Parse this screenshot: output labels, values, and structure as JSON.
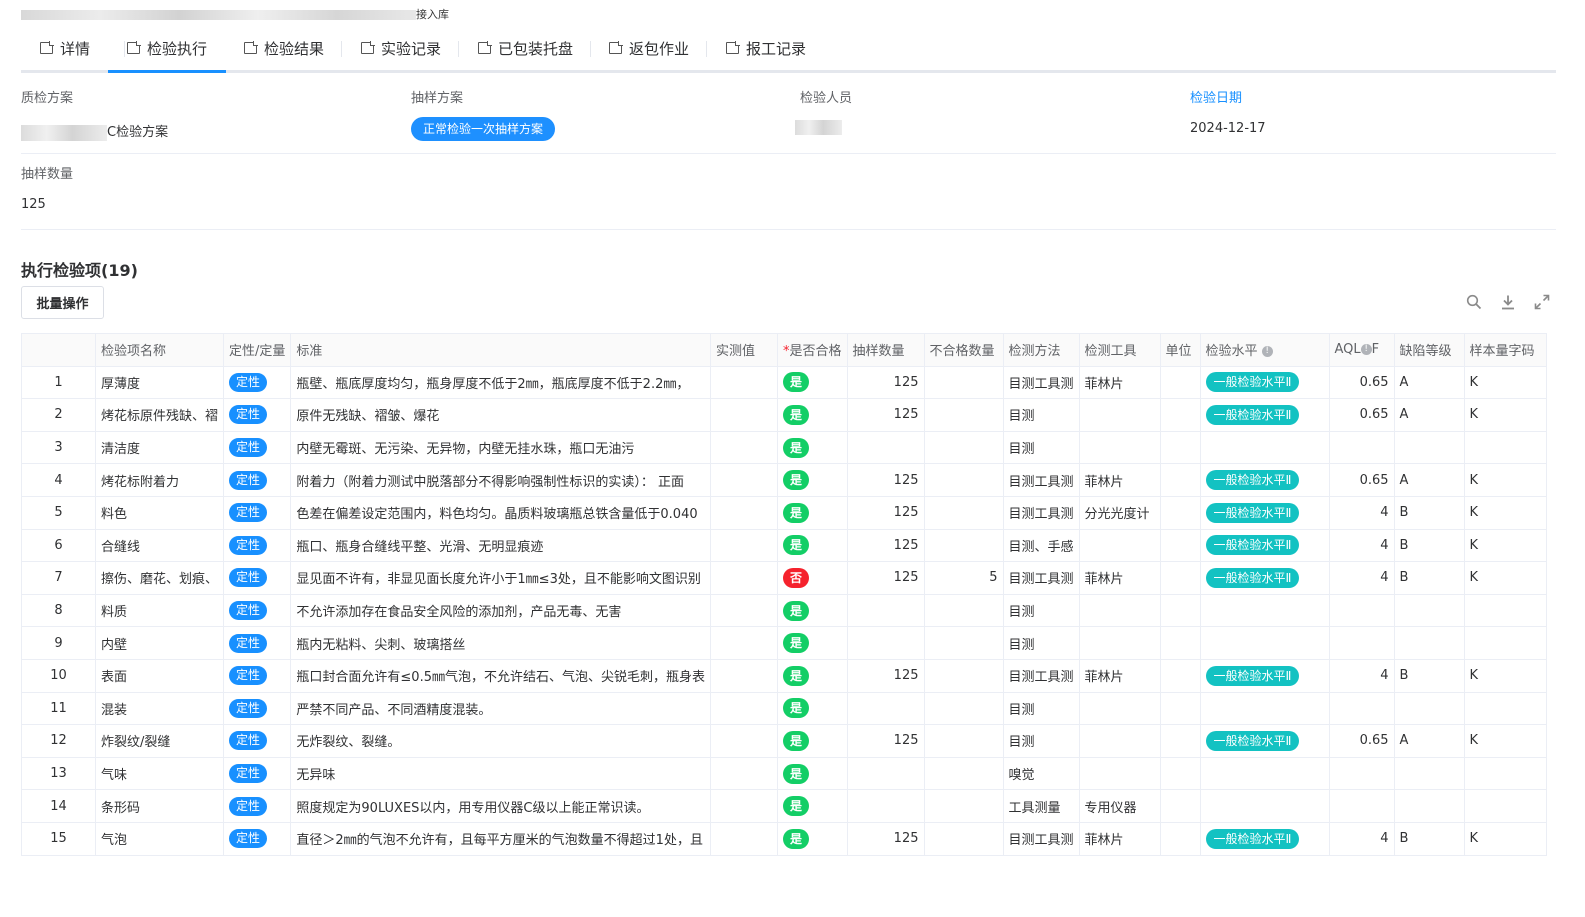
{
  "breadcrumb": {
    "text": "接入库"
  },
  "tabs": [
    {
      "label": "详情"
    },
    {
      "label": "检验执行"
    },
    {
      "label": "检验结果"
    },
    {
      "label": "实验记录"
    },
    {
      "label": "已包装托盘"
    },
    {
      "label": "返包作业"
    },
    {
      "label": "报工记录"
    }
  ],
  "fields": {
    "qc_plan_label": "质检方案",
    "qc_plan_value": "C检验方案",
    "sampling_plan_label": "抽样方案",
    "sampling_plan_value": "正常检验一次抽样方案",
    "inspector_label": "检验人员",
    "inspect_date_label": "检验日期",
    "inspect_date_value": "2024-12-17",
    "sample_qty_label": "抽样数量",
    "sample_qty_value": "125"
  },
  "section": {
    "title": "执行检验项(19)",
    "batch_button": "批量操作"
  },
  "toolbar": {
    "icons": [
      "search-icon",
      "download-icon",
      "fullscreen-icon"
    ]
  },
  "table": {
    "headers": {
      "name": "检验项名称",
      "qual": "定性/定量",
      "std": "标准",
      "measured": "实测值",
      "pass_req": "*",
      "pass": "是否合格",
      "sample": "抽样数量",
      "fail": "不合格数量",
      "method": "检测方法",
      "tool": "检测工具",
      "unit": "单位",
      "level": "检验水平",
      "aql": "AQL",
      "aql_tail": "F",
      "defect": "缺陷等级",
      "code": "样本量字码"
    },
    "rows": [
      {
        "idx": "1",
        "name": "厚薄度",
        "qual": "定性",
        "std": "瓶壁、瓶底厚度均匀，瓶身厚度不低于2㎜，瓶底厚度不低于2.2㎜，",
        "pass": "是",
        "sample": "125",
        "fail": "",
        "method": "目测工具测",
        "tool": "菲林片",
        "unit": "",
        "level": "一般检验水平Ⅱ",
        "aql": "0.65",
        "defect": "A",
        "code": "K"
      },
      {
        "idx": "2",
        "name": "烤花标原件残缺、褶",
        "qual": "定性",
        "std": "原件无残缺、褶皱、爆花",
        "pass": "是",
        "sample": "125",
        "fail": "",
        "method": "目测",
        "tool": "",
        "unit": "",
        "level": "一般检验水平Ⅱ",
        "aql": "0.65",
        "defect": "A",
        "code": "K"
      },
      {
        "idx": "3",
        "name": "清洁度",
        "qual": "定性",
        "std": "内壁无霉斑、无污染、无异物，内壁无挂水珠，瓶口无油污",
        "pass": "是",
        "sample": "",
        "fail": "",
        "method": "目测",
        "tool": "",
        "unit": "",
        "level": "",
        "aql": "",
        "defect": "",
        "code": ""
      },
      {
        "idx": "4",
        "name": "烤花标附着力",
        "qual": "定性",
        "std": "附着力（附着力测试中脱落部分不得影响强制性标识的实读）： 正面",
        "pass": "是",
        "sample": "125",
        "fail": "",
        "method": "目测工具测",
        "tool": "菲林片",
        "unit": "",
        "level": "一般检验水平Ⅱ",
        "aql": "0.65",
        "defect": "A",
        "code": "K"
      },
      {
        "idx": "5",
        "name": "料色",
        "qual": "定性",
        "std": "色差在偏差设定范围内，料色均匀。晶质料玻璃瓶总铁含量低于0.040",
        "pass": "是",
        "sample": "125",
        "fail": "",
        "method": "目测工具测",
        "tool": "分光光度计",
        "unit": "",
        "level": "一般检验水平Ⅱ",
        "aql": "4",
        "defect": "B",
        "code": "K"
      },
      {
        "idx": "6",
        "name": "合缝线",
        "qual": "定性",
        "std": "瓶口、瓶身合缝线平整、光滑、无明显痕迹",
        "pass": "是",
        "sample": "125",
        "fail": "",
        "method": "目测、手感",
        "tool": "",
        "unit": "",
        "level": "一般检验水平Ⅱ",
        "aql": "4",
        "defect": "B",
        "code": "K"
      },
      {
        "idx": "7",
        "name": "擦伤、磨花、划痕、",
        "qual": "定性",
        "std": "显见面不许有，非显见面长度允许小于1㎜≤3处，且不能影响文图识别",
        "pass": "否",
        "sample": "125",
        "fail": "5",
        "method": "目测工具测",
        "tool": "菲林片",
        "unit": "",
        "level": "一般检验水平Ⅱ",
        "aql": "4",
        "defect": "B",
        "code": "K"
      },
      {
        "idx": "8",
        "name": "料质",
        "qual": "定性",
        "std": "不允许添加存在食品安全风险的添加剂，产品无毒、无害",
        "pass": "是",
        "sample": "",
        "fail": "",
        "method": "目测",
        "tool": "",
        "unit": "",
        "level": "",
        "aql": "",
        "defect": "",
        "code": ""
      },
      {
        "idx": "9",
        "name": "内壁",
        "qual": "定性",
        "std": "瓶内无粘料、尖刺、玻璃搭丝",
        "pass": "是",
        "sample": "",
        "fail": "",
        "method": "目测",
        "tool": "",
        "unit": "",
        "level": "",
        "aql": "",
        "defect": "",
        "code": ""
      },
      {
        "idx": "10",
        "name": "表面",
        "qual": "定性",
        "std": "瓶口封合面允许有≤0.5㎜气泡，不允许结石、气泡、尖锐毛刺，瓶身表",
        "pass": "是",
        "sample": "125",
        "fail": "",
        "method": "目测工具测",
        "tool": "菲林片",
        "unit": "",
        "level": "一般检验水平Ⅱ",
        "aql": "4",
        "defect": "B",
        "code": "K"
      },
      {
        "idx": "11",
        "name": "混装",
        "qual": "定性",
        "std": "严禁不同产品、不同酒精度混装。",
        "pass": "是",
        "sample": "",
        "fail": "",
        "method": "目测",
        "tool": "",
        "unit": "",
        "level": "",
        "aql": "",
        "defect": "",
        "code": ""
      },
      {
        "idx": "12",
        "name": "炸裂纹/裂缝",
        "qual": "定性",
        "std": "无炸裂纹、裂缝。",
        "pass": "是",
        "sample": "125",
        "fail": "",
        "method": "目测",
        "tool": "",
        "unit": "",
        "level": "一般检验水平Ⅱ",
        "aql": "0.65",
        "defect": "A",
        "code": "K"
      },
      {
        "idx": "13",
        "name": "气味",
        "qual": "定性",
        "std": "无异味",
        "pass": "是",
        "sample": "",
        "fail": "",
        "method": "嗅觉",
        "tool": "",
        "unit": "",
        "level": "",
        "aql": "",
        "defect": "",
        "code": ""
      },
      {
        "idx": "14",
        "name": "条形码",
        "qual": "定性",
        "std": "照度规定为90LUXES以内，用专用仪器C级以上能正常识读。",
        "pass": "是",
        "sample": "",
        "fail": "",
        "method": "工具测量",
        "tool": "专用仪器",
        "unit": "",
        "level": "",
        "aql": "",
        "defect": "",
        "code": ""
      },
      {
        "idx": "15",
        "name": "气泡",
        "qual": "定性",
        "std": "直径＞2㎜的气泡不允许有，且每平方厘米的气泡数量不得超过1处，且",
        "pass": "是",
        "sample": "125",
        "fail": "",
        "method": "目测工具测",
        "tool": "菲林片",
        "unit": "",
        "level": "一般检验水平Ⅱ",
        "aql": "4",
        "defect": "B",
        "code": "K"
      }
    ]
  }
}
